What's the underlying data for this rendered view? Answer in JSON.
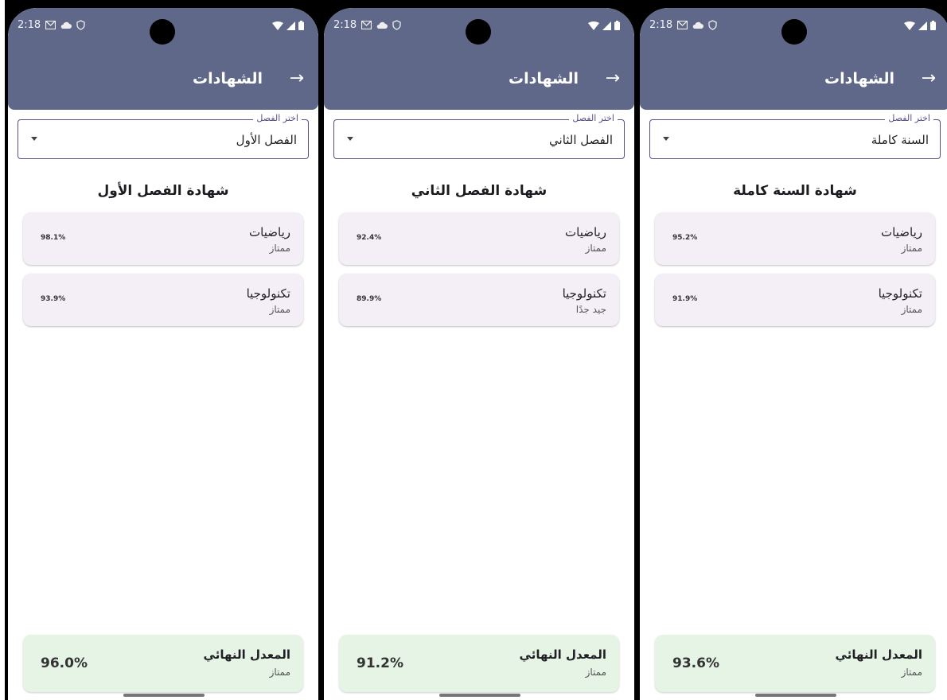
{
  "status_time": "2:18",
  "app_title": "الشهادات",
  "dropdown_label": "اختر الفصل",
  "colors": {
    "appbar": "#5f6888",
    "card": "#f4eff7",
    "final_card": "#e6f4e6",
    "outline": "#5a4d8a"
  },
  "screens": [
    {
      "selected": "الفصل الأول",
      "heading": "شهادة الفصل الأول",
      "subjects": [
        {
          "name": "رياضيات",
          "grade": "ممتاز",
          "percent": "98.1%"
        },
        {
          "name": "تكنولوجيا",
          "grade": "ممتاز",
          "percent": "93.9%"
        }
      ],
      "final": {
        "title": "المعدل النهائي",
        "grade": "ممتاز",
        "percent": "96.0%"
      }
    },
    {
      "selected": "الفصل الثاني",
      "heading": "شهادة الفصل الثاني",
      "subjects": [
        {
          "name": "رياضيات",
          "grade": "ممتاز",
          "percent": "92.4%"
        },
        {
          "name": "تكنولوجيا",
          "grade": "جيد جدًا",
          "percent": "89.9%"
        }
      ],
      "final": {
        "title": "المعدل النهائي",
        "grade": "ممتاز",
        "percent": "91.2%"
      }
    },
    {
      "selected": "السنة كاملة",
      "heading": "شهادة السنة كاملة",
      "subjects": [
        {
          "name": "رياضيات",
          "grade": "ممتاز",
          "percent": "95.2%"
        },
        {
          "name": "تكنولوجيا",
          "grade": "ممتاز",
          "percent": "91.9%"
        }
      ],
      "final": {
        "title": "المعدل النهائي",
        "grade": "ممتاز",
        "percent": "93.6%"
      }
    }
  ]
}
